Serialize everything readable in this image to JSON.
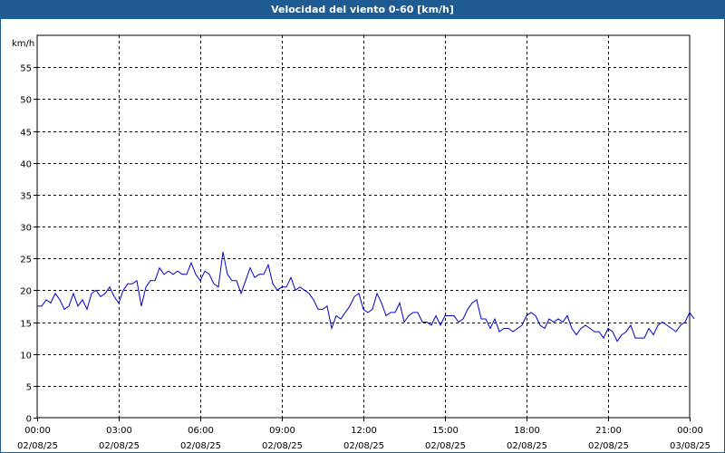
{
  "title": "Velocidad del viento 0-60 [km/h]",
  "colors": {
    "title_bar": "#1e5b92",
    "line": "#0000cc",
    "grid": "#000000"
  },
  "chart_data": {
    "type": "line",
    "title": "Velocidad del viento 0-60 [km/h]",
    "ylabel": "km/h",
    "xlabel": "",
    "ylim": [
      0,
      60
    ],
    "yticks": [
      0,
      5,
      10,
      15,
      20,
      25,
      30,
      35,
      40,
      45,
      50,
      55
    ],
    "xlim_hours": [
      0,
      24
    ],
    "xticks": [
      {
        "hour": 0,
        "time": "00:00",
        "date": "02/08/25"
      },
      {
        "hour": 3,
        "time": "03:00",
        "date": "02/08/25"
      },
      {
        "hour": 6,
        "time": "06:00",
        "date": "02/08/25"
      },
      {
        "hour": 9,
        "time": "09:00",
        "date": "02/08/25"
      },
      {
        "hour": 12,
        "time": "12:00",
        "date": "02/08/25"
      },
      {
        "hour": 15,
        "time": "15:00",
        "date": "02/08/25"
      },
      {
        "hour": 18,
        "time": "18:00",
        "date": "02/08/25"
      },
      {
        "hour": 21,
        "time": "21:00",
        "date": "02/08/25"
      },
      {
        "hour": 24,
        "time": "00:00",
        "date": "03/08/25"
      }
    ],
    "grid": true,
    "series": [
      {
        "x_start_hour": 0,
        "x_step_hour": 0.166667,
        "values": [
          17.5,
          17.5,
          18.5,
          18,
          19.5,
          18.5,
          17,
          17.5,
          19.5,
          17.5,
          18.5,
          17,
          19.5,
          20,
          19,
          19.5,
          20.5,
          19,
          18,
          20,
          21,
          21,
          21.5,
          17.5,
          20.5,
          21.5,
          21.5,
          23.5,
          22.5,
          23,
          22.5,
          23,
          22.5,
          22.5,
          24.3,
          22.5,
          21.5,
          23,
          22.5,
          21,
          20.5,
          26,
          22.5,
          21.5,
          21.5,
          19.5,
          21.5,
          23.5,
          22,
          22.5,
          22.5,
          24,
          21,
          20,
          20.5,
          20.5,
          22,
          20,
          20.5,
          20,
          19.5,
          18.5,
          17,
          17,
          17.5,
          14,
          16,
          15.5,
          16.5,
          17.5,
          19,
          19.5,
          17,
          16.5,
          17,
          19.5,
          18,
          16,
          16.5,
          16.5,
          18,
          15,
          16,
          16.5,
          16.5,
          15,
          15,
          14.5,
          16,
          14.5,
          16,
          16,
          16,
          15,
          15.5,
          17,
          18,
          18.5,
          15.5,
          15.5,
          14,
          15.5,
          13.5,
          14,
          14,
          13.5,
          14,
          14.5,
          16,
          16.5,
          16,
          14.5,
          14,
          15.5,
          15,
          15.5,
          15,
          16,
          14,
          13,
          14,
          14.5,
          14,
          13.5,
          13.5,
          12.5,
          14,
          13.5,
          12,
          13,
          13.5,
          14.5,
          12.5,
          12.5,
          12.5,
          14,
          13,
          14.5,
          15,
          14.5,
          14,
          13.5,
          14.5,
          15,
          16.5,
          15.5
        ]
      }
    ]
  }
}
